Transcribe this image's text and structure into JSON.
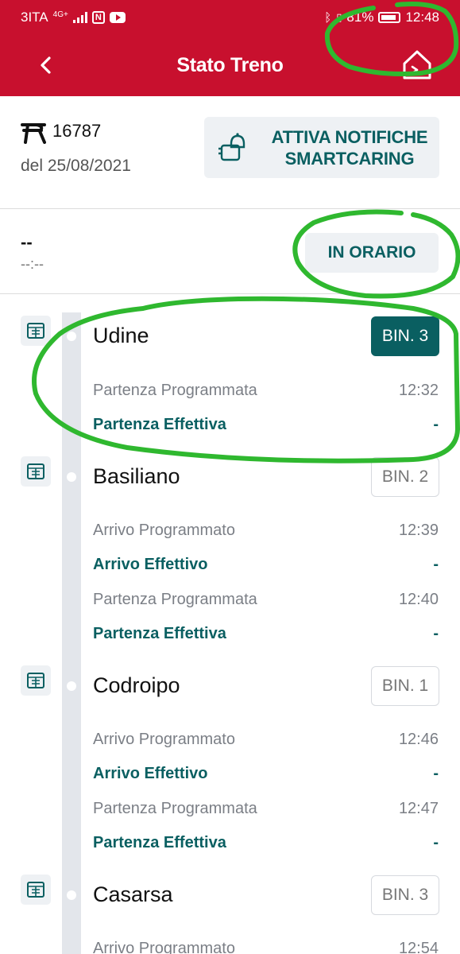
{
  "status_bar": {
    "carrier": "3ITA",
    "network": "4G+",
    "battery": "81%",
    "time": "12:48"
  },
  "toolbar": {
    "title": "Stato Treno"
  },
  "train": {
    "number": "16787",
    "date": "del 25/08/2021",
    "notify_line1": "ATTIVA NOTIFICHE",
    "notify_line2": "SMARTCARING"
  },
  "current": {
    "station": "--",
    "time": "--:--",
    "status": "IN ORARIO"
  },
  "stops": [
    {
      "name": "Udine",
      "platform": "BIN. 3",
      "rows": [
        {
          "label": "Partenza Programmata",
          "value": "12:32",
          "effective": false
        },
        {
          "label": "Partenza Effettiva",
          "value": "-",
          "effective": true
        }
      ]
    },
    {
      "name": "Basiliano",
      "platform": "BIN. 2",
      "rows": [
        {
          "label": "Arrivo Programmato",
          "value": "12:39",
          "effective": false
        },
        {
          "label": "Arrivo Effettivo",
          "value": "-",
          "effective": true
        },
        {
          "label": "Partenza Programmata",
          "value": "12:40",
          "effective": false
        },
        {
          "label": "Partenza Effettiva",
          "value": "-",
          "effective": true
        }
      ]
    },
    {
      "name": "Codroipo",
      "platform": "BIN. 1",
      "rows": [
        {
          "label": "Arrivo Programmato",
          "value": "12:46",
          "effective": false
        },
        {
          "label": "Arrivo Effettivo",
          "value": "-",
          "effective": true
        },
        {
          "label": "Partenza Programmata",
          "value": "12:47",
          "effective": false
        },
        {
          "label": "Partenza Effettiva",
          "value": "-",
          "effective": true
        }
      ]
    },
    {
      "name": "Casarsa",
      "platform": "BIN. 3",
      "rows": [
        {
          "label": "Arrivo Programmato",
          "value": "12:54",
          "effective": false
        }
      ]
    }
  ],
  "colors": {
    "brand_red": "#c8102e",
    "teal": "#0a5f61",
    "annotation_green": "#2fb82f"
  }
}
